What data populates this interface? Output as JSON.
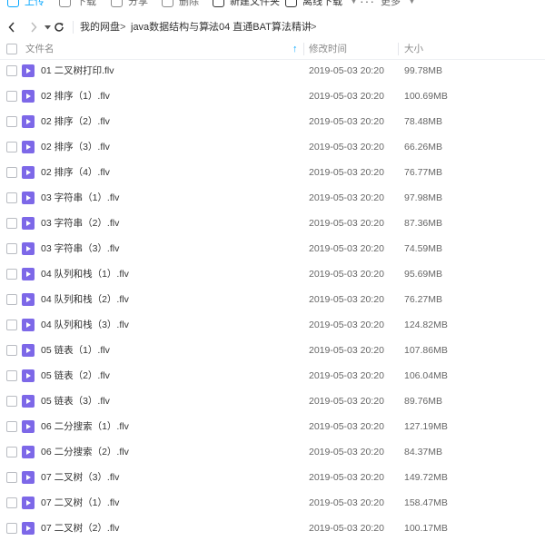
{
  "toolbar": {
    "upload_label": "上传",
    "download_label": "下载",
    "share_label": "分享",
    "delete_label": "删除",
    "new_folder_label": "新建文件夹",
    "offline_download_label": "离线下载",
    "more_label": "更多"
  },
  "nav": {
    "breadcrumbs": [
      "我的网盘",
      "java数据结构与算法",
      "04 直通BAT算法精讲"
    ],
    "separator": ">"
  },
  "table": {
    "headers": {
      "name": "文件名",
      "modified": "修改时间",
      "size": "大小"
    },
    "rows": [
      {
        "name": "01 二叉树打印.flv",
        "modified": "2019-05-03 20:20",
        "size": "99.78MB"
      },
      {
        "name": "02 排序（1）.flv",
        "modified": "2019-05-03 20:20",
        "size": "100.69MB"
      },
      {
        "name": "02 排序（2）.flv",
        "modified": "2019-05-03 20:20",
        "size": "78.48MB"
      },
      {
        "name": "02 排序（3）.flv",
        "modified": "2019-05-03 20:20",
        "size": "66.26MB"
      },
      {
        "name": "02 排序（4）.flv",
        "modified": "2019-05-03 20:20",
        "size": "76.77MB"
      },
      {
        "name": "03 字符串（1）.flv",
        "modified": "2019-05-03 20:20",
        "size": "97.98MB"
      },
      {
        "name": "03 字符串（2）.flv",
        "modified": "2019-05-03 20:20",
        "size": "87.36MB"
      },
      {
        "name": "03 字符串（3）.flv",
        "modified": "2019-05-03 20:20",
        "size": "74.59MB"
      },
      {
        "name": "04 队列和栈（1）.flv",
        "modified": "2019-05-03 20:20",
        "size": "95.69MB"
      },
      {
        "name": "04 队列和栈（2）.flv",
        "modified": "2019-05-03 20:20",
        "size": "76.27MB"
      },
      {
        "name": "04 队列和栈（3）.flv",
        "modified": "2019-05-03 20:20",
        "size": "124.82MB"
      },
      {
        "name": "05 链表（1）.flv",
        "modified": "2019-05-03 20:20",
        "size": "107.86MB"
      },
      {
        "name": "05 链表（2）.flv",
        "modified": "2019-05-03 20:20",
        "size": "106.04MB"
      },
      {
        "name": "05 链表（3）.flv",
        "modified": "2019-05-03 20:20",
        "size": "89.76MB"
      },
      {
        "name": "06 二分搜索（1）.flv",
        "modified": "2019-05-03 20:20",
        "size": "127.19MB"
      },
      {
        "name": "06 二分搜索（2）.flv",
        "modified": "2019-05-03 20:20",
        "size": "84.37MB"
      },
      {
        "name": "07 二叉树（3）.flv",
        "modified": "2019-05-03 20:20",
        "size": "149.72MB"
      },
      {
        "name": "07 二叉树（1）.flv",
        "modified": "2019-05-03 20:20",
        "size": "158.47MB"
      },
      {
        "name": "07 二叉树（2）.flv",
        "modified": "2019-05-03 20:20",
        "size": "100.17MB"
      }
    ]
  },
  "colors": {
    "accent": "#06a7ff",
    "video_icon": "#7d68e8"
  },
  "icons": {
    "upload": "upload-icon",
    "download": "download-icon",
    "share": "share-icon",
    "delete": "trash-icon",
    "new_folder": "folder-plus-icon",
    "offline": "offline-download-icon",
    "more": "more-dots-icon",
    "back": "chevron-left-icon",
    "forward": "chevron-right-icon",
    "refresh": "refresh-icon",
    "file": "video-file-icon",
    "sort": "sort-up-arrow-icon"
  }
}
